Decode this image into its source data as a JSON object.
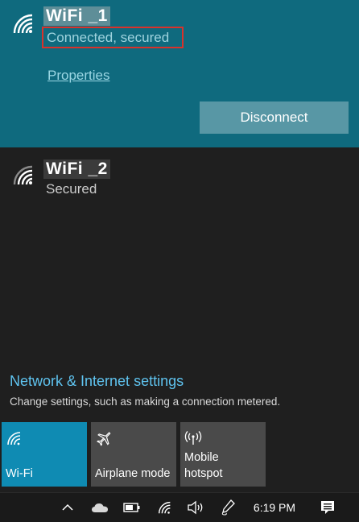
{
  "networks": {
    "active": {
      "name": "WiFi _1",
      "status": "Connected, secured",
      "properties_label": "Properties",
      "disconnect_label": "Disconnect"
    },
    "other": {
      "name": "WiFi _2",
      "status": "Secured"
    }
  },
  "settings": {
    "link_label": "Network & Internet settings",
    "description": "Change settings, such as making a connection metered."
  },
  "quick_actions": [
    {
      "label": "Wi-Fi",
      "icon": "wifi-icon",
      "state": "on"
    },
    {
      "label": "Airplane mode",
      "icon": "airplane-icon",
      "state": "off"
    },
    {
      "label": "Mobile hotspot",
      "icon": "hotspot-icon",
      "state": "off"
    }
  ],
  "taskbar": {
    "time": "6:19 PM",
    "icons": [
      "chevron-up-icon",
      "onedrive-cloud-icon",
      "battery-icon",
      "wifi-icon",
      "volume-icon",
      "pen-icon",
      "action-center-icon"
    ]
  },
  "colors": {
    "active_bg": "#0f6a7e",
    "panel_bg": "#1f1f1f",
    "tile_on": "#0f8bb3",
    "tile_off": "#4a4a4a",
    "link": "#5fc3ef",
    "highlight": "#d9322b"
  }
}
